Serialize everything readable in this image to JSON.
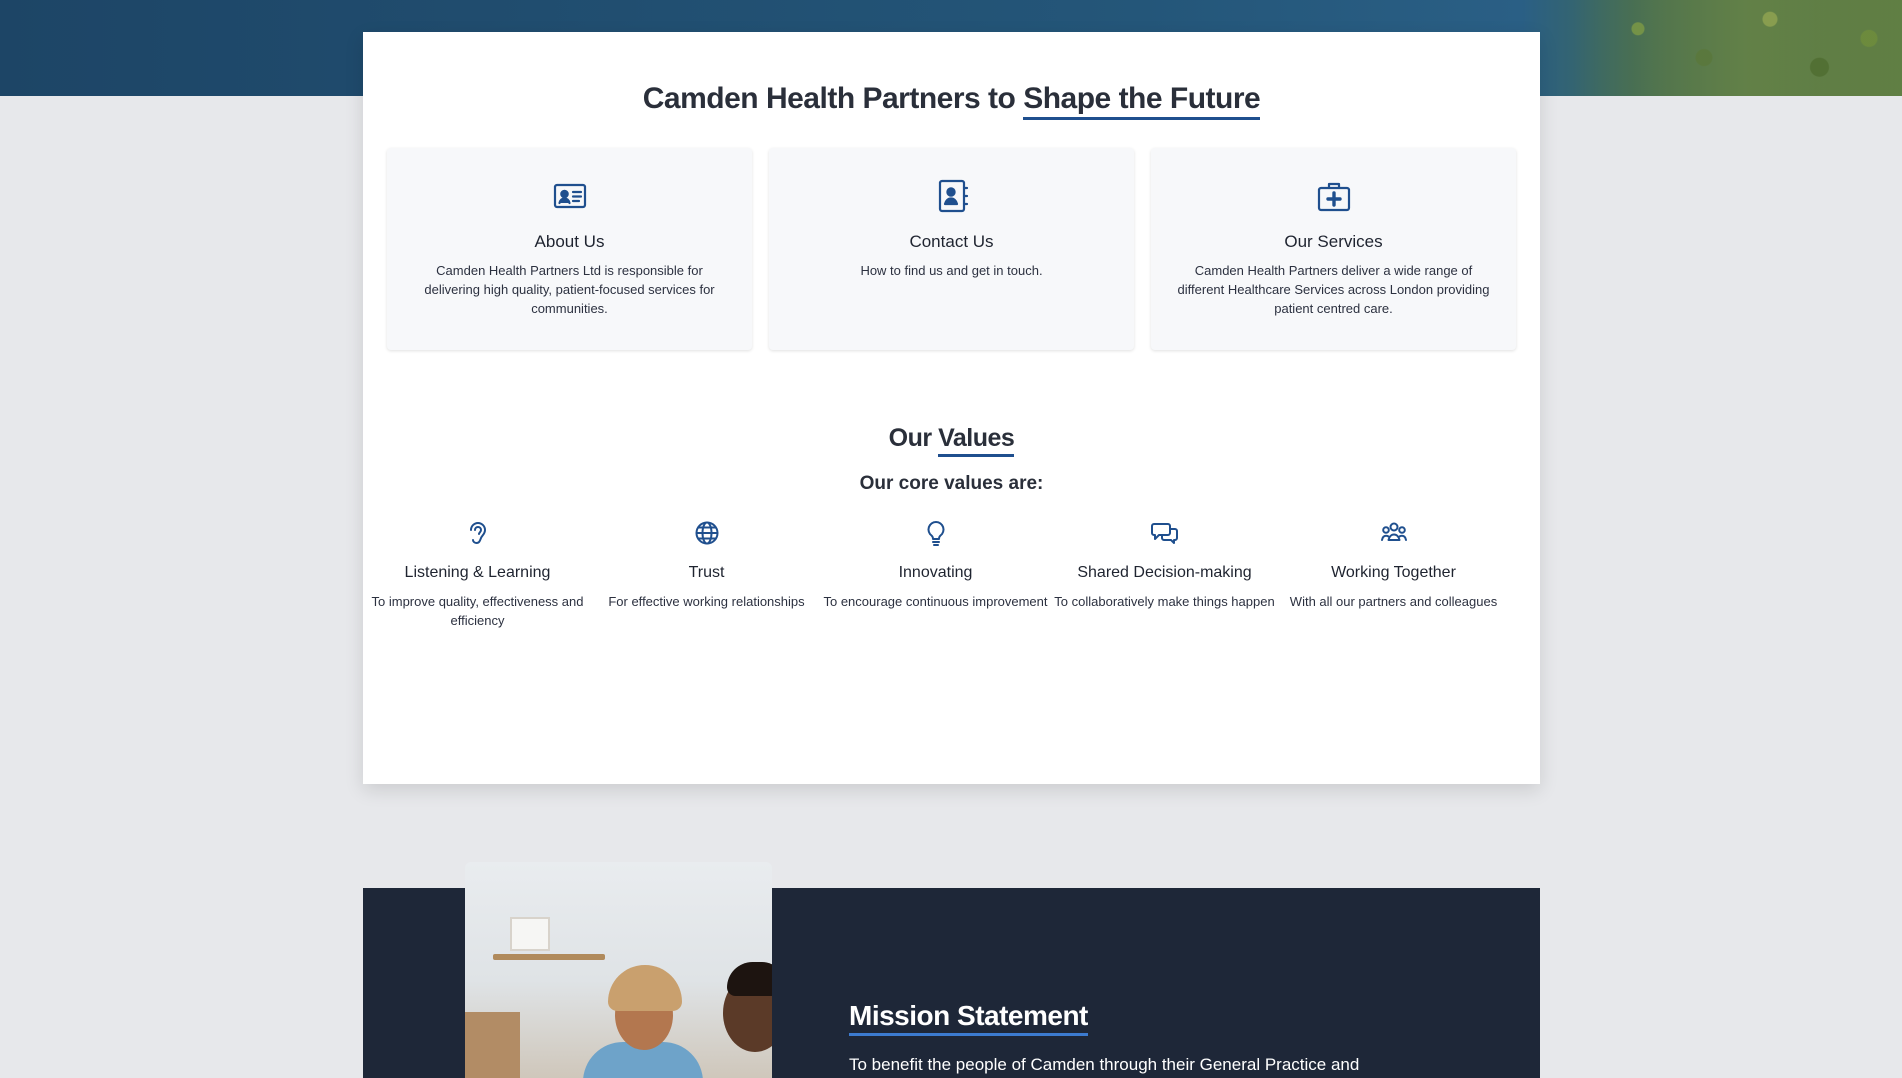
{
  "colors": {
    "accent": "#1f4f8e",
    "hero": "#245679",
    "card_bg": "#f7f8fa",
    "mission_bg": "#1e2738",
    "page_bg": "#e7e8eb"
  },
  "intro": {
    "title_prefix": "Camden Health Partners to ",
    "title_highlight": "Shape the Future"
  },
  "cards": [
    {
      "icon": "id-card-icon",
      "title": "About Us",
      "text": "Camden Health Partners Ltd is responsible for delivering high quality, patient-focused services for communities."
    },
    {
      "icon": "contact-book-icon",
      "title": "Contact Us",
      "text": "How to find us and get in touch."
    },
    {
      "icon": "medical-kit-icon",
      "title": "Our Services",
      "text": "Camden Health Partners deliver a wide range of different Healthcare Services across London providing patient centred care."
    }
  ],
  "values_section": {
    "title_prefix": "Our ",
    "title_highlight": "Values",
    "subtitle": "Our core values are:",
    "items": [
      {
        "icon": "ear-icon",
        "title": "Listening & Learning",
        "text": "To improve quality, effectiveness and efficiency"
      },
      {
        "icon": "globe-icon",
        "title": "Trust",
        "text": "For effective working relationships"
      },
      {
        "icon": "lightbulb-icon",
        "title": "Innovating",
        "text": "To encourage continuous improvement"
      },
      {
        "icon": "chat-bubbles-icon",
        "title": "Shared Decision-making",
        "text": "To collaboratively make things happen"
      },
      {
        "icon": "team-icon",
        "title": "Working Together",
        "text": "With all our partners and colleagues"
      }
    ]
  },
  "mission": {
    "title_highlight": "Mission Statement",
    "text": "To benefit the people of Camden through their General Practice and"
  }
}
